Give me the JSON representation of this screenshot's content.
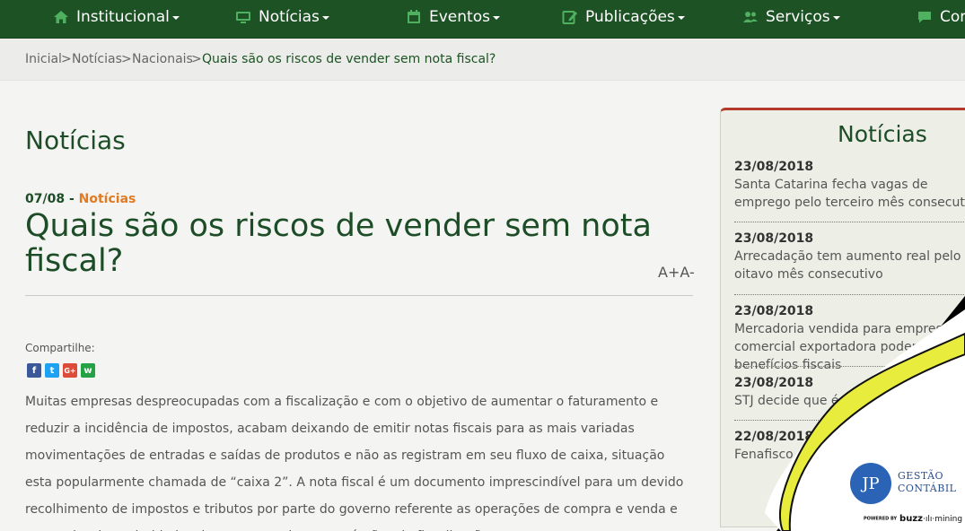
{
  "nav": {
    "items": [
      {
        "label": "Institucional",
        "icon": "home-icon"
      },
      {
        "label": "Notícias",
        "icon": "monitor-icon"
      },
      {
        "label": "Eventos",
        "icon": "calendar-icon"
      },
      {
        "label": "Publicações",
        "icon": "edit-icon"
      },
      {
        "label": "Serviços",
        "icon": "users-icon"
      },
      {
        "label": "Con",
        "icon": "chat-icon"
      }
    ]
  },
  "breadcrumb": {
    "items": [
      "Inicial",
      ">",
      "Notícias",
      ">",
      "Nacionais",
      ">"
    ],
    "current": "Quais são os riscos de vender sem nota fiscal?"
  },
  "page": {
    "section_title": "Notícias",
    "date": "07/08",
    "separator": " - ",
    "category": "Notícias",
    "headline": "Quais são os riscos de vender sem nota fiscal?",
    "font_increase": "A+",
    "font_decrease": "A-",
    "share_label": "Compartilhe:",
    "share_icons": [
      "facebook-icon",
      "twitter-icon",
      "google-plus-icon",
      "whatsapp-icon"
    ],
    "share_glyphs": [
      "f",
      "t",
      "G+",
      "w"
    ],
    "body": "Muitas empresas despreocupadas com a fiscalização e com o objetivo de aumentar o faturamento e reduzir a incidência de impostos, acabam deixando de emitir notas fiscais para as mais variadas movimentações de entradas e saídas de produtos e não as registram em seu fluxo de caixa, situação esta popularmente chamada de “caixa 2”. A nota fiscal é um documento imprescindível para um devido recolhimento de impostos e tributos por parte do governo referente as operações de compra e venda e para evitar irregularidades das empresas junto aos órgãos de fiscalização."
  },
  "sidebar": {
    "title": "Notícias",
    "news": [
      {
        "date": "23/08/2018",
        "title": "Santa Catarina fecha vagas de emprego pelo terceiro mês consecutivo"
      },
      {
        "date": "23/08/2018",
        "title": "Arrecadação tem aumento real pelo oitavo mês consecutivo"
      },
      {
        "date": "23/08/2018",
        "title": "Mercadoria vendida para empresa comercial exportadora poderá ter benefícios fiscais"
      },
      {
        "date": "23/08/2018",
        "title": "STJ decide que é"
      },
      {
        "date": "22/08/2018",
        "title": "Fenafisco políti"
      }
    ]
  },
  "overlay": {
    "logo_mark": "JP",
    "logo_line1": "GESTÃO",
    "logo_line2": "CONTÁBIL",
    "powered_by": "POWERED BY",
    "brand_a": "buzz",
    "brand_b": "mining"
  },
  "colors": {
    "nav_bg": "#1c5224",
    "accent_green": "#1c4d27",
    "category_orange": "#e07b22",
    "sidebar_top": "#b33a2a",
    "curl_yellow": "#e8ec3c",
    "facebook": "#3b5998",
    "twitter": "#1da1f2",
    "google_plus": "#dd4b39",
    "whatsapp": "#25a244"
  }
}
